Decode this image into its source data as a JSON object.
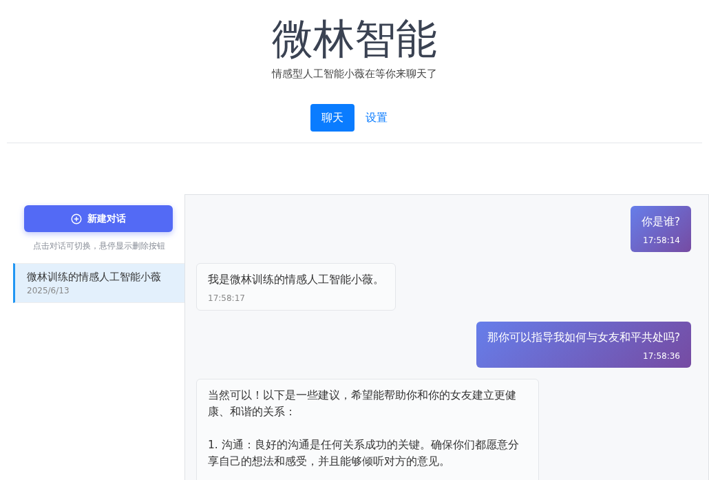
{
  "header": {
    "title": "微林智能",
    "subtitle": "情感型人工智能小薇在等你来聊天了"
  },
  "tabs": [
    {
      "label": "聊天",
      "selected": true
    },
    {
      "label": "设置",
      "selected": false
    }
  ],
  "sidebar": {
    "new_button": "新建对话",
    "hint": "点击对话可切换，悬停显示删除按钮",
    "conversations": [
      {
        "title": "微林训练的情感人工智能小薇",
        "date": "2025/6/13",
        "selected": true
      }
    ]
  },
  "messages": [
    {
      "kind": "user",
      "text": "你是谁?",
      "time": "17:58:14"
    },
    {
      "kind": "assistant",
      "text": "我是微林训练的情感人工智能小薇。",
      "time": "17:58:17"
    },
    {
      "kind": "user",
      "text": "那你可以指导我如何与女友和平共处吗?",
      "time": "17:58:36"
    },
    {
      "kind": "assistant",
      "text": "当然可以！以下是一些建议，希望能帮助你和你的女友建立更健康、和谐的关系：\n\n1. 沟通：良好的沟通是任何关系成功的关键。确保你们都愿意分享自己的想法和感受，并且能够倾听对方的意见。\n\n"
    }
  ]
}
